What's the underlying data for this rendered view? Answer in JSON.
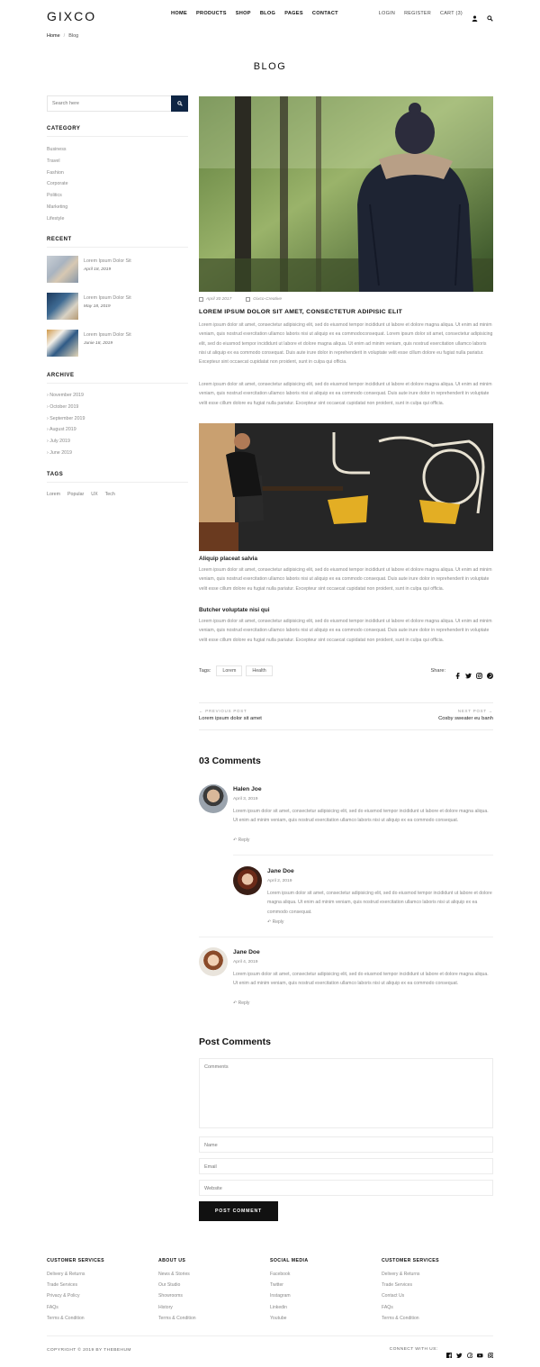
{
  "brand": {
    "logo": "GIXCO"
  },
  "nav": {
    "main": [
      "HOME",
      "PRODUCTS",
      "SHOP",
      "BLOG",
      "PAGES",
      "CONTACT"
    ],
    "login": "LOGIN",
    "register": "REGISTER",
    "cart": "CART (3)",
    "icons": [
      "user-icon",
      "search-icon"
    ]
  },
  "breadcrumb": {
    "home": "Home",
    "sep": "/",
    "current": "Blog"
  },
  "page_title": "BLOG",
  "sidebar": {
    "search_placeholder": "Search here",
    "category_heading": "CATEGORY",
    "categories": [
      "Business",
      "Travel",
      "Fashion",
      "Corporate",
      "Politics",
      "Marketing",
      "Lifestyle"
    ],
    "recent_heading": "RECENT",
    "recent": [
      {
        "title": "Lorem Ipsum Dolor Sit",
        "date": "April 18, 2019"
      },
      {
        "title": "Lorem Ipsum Dolor Sit",
        "date": "May 18, 2019"
      },
      {
        "title": "Lorem Ipsum Dolor Sit",
        "date": "Junie 18, 2019"
      }
    ],
    "archive_heading": "ARCHIVE",
    "archive": [
      "November 2019",
      "October 2019",
      "September 2019",
      "August 2019",
      "July 2019",
      "June 2019"
    ],
    "tags_heading": "TAGS",
    "tags": [
      "Lorem",
      "Popular",
      "UX",
      "Tech"
    ]
  },
  "post": {
    "date": "April 30 2017",
    "author": "Gixco-Creative",
    "title": "LOREM IPSUM DOLOR SIT AMET, CONSECTETUR ADIPISIC ELIT",
    "para1": "Lorem ipsum dolor sit amet, consectetur adipisicing elit, sed do eiusmod tempor incididunt ut labore et dolore magna aliqua. Ut enim ad minim veniam, quis nostrud exercitation ullamco laboris nisi ut aliquip ex ea commodoconsequat. Lorem ipsum dolor sit amet, consectetur adipisicing elit, sed do eiusmod tempor incididunt ut labore et dolore magna aliqua. Ut enim ad minim veniam, quis nostrud exercitation ullamco laboris nisi ut aliquip ex ea commodo consequat. Duis aute irure dolor in reprehenderit in voluptate velit esse cillum dolore eu fugiat nulla pariatur. Excepteur sint occaecat cupidatat non proident, sunt in culpa qui officia.",
    "para2": "Lorem ipsum dolor sit amet, consectetur adipisicing elit, sed do eiusmod tempor incididunt ut labore et dolore magna aliqua. Ut enim ad minim veniam, quis nostrud exercitation ullamco laboris nisi ut aliquip ex ea commodo consequat. Duis aute irure dolor in reprehenderit in voluptate velit esse cillum dolore eu fugiat nulla pariatur. Excepteur sint occaecat cupidatat non proident, sunt in culpa qui officia.",
    "sub1": "Aliquip placeat salvia",
    "para3": "Lorem ipsum dolor sit amet, consectetur adipisicing elit, sed do eiusmod tempor incididunt ut labore et dolore magna aliqua. Ut enim ad minim veniam, quis nostrud exercitation ullamco laboris nisi ut aliquip ex ea commodo consequat. Duis aute irure dolor in reprehenderit in voluptate velit esse cillum dolore eu fugiat nulla pariatur. Excepteur sint occaecat cupidatat non proident, sunt in culpa qui officia.",
    "sub2": "Butcher voluptate nisi qui",
    "para4": "Lorem ipsum dolor sit amet, consectetur adipisicing elit, sed do eiusmod tempor incididunt ut labore et dolore magna aliqua. Ut enim ad minim veniam, quis nostrud exercitation ullamco laboris nisi ut aliquip ex ea commodo consequat. Duis aute irure dolor in reprehenderit in voluptate velit esse cillum dolore eu fugiat nulla pariatur. Excepteur sint occaecat cupidatat non proident, sunt in culpa qui officia.",
    "tags_label": "Tags:",
    "tags": [
      "Lorem",
      "Health"
    ],
    "share_label": "Share:",
    "share_icons": [
      "facebook-icon",
      "twitter-icon",
      "instagram-icon",
      "pinterest-icon"
    ]
  },
  "pager": {
    "prev_label": "← PREVIOUS POST",
    "prev_title": "Lorem ipsum dolor sit amet",
    "next_label": "NEXT POST →",
    "next_title": "Cosby sweater eu banh"
  },
  "comments": {
    "heading": "03 Comments",
    "items": [
      {
        "name": "Halen Joe",
        "date": "April 3, 2019",
        "text": "Lorem ipsum dolor sit amet, consectetur adipisicing elit, sed do eiusmod tempor incididunt ut labore et dolore magna aliqua. Ut enim ad minim veniam, quis nostrud exercitation ullamco laboris nisi ut aliquip ex ea commodo consequat.",
        "reply": "Reply"
      },
      {
        "name": "Jane Doe",
        "date": "April 2, 2019",
        "text": "Lorem ipsum dolor sit amet, consectetur adipisicing elit, sed do eiusmod tempor incididunt ut labore et dolore magna aliqua. Ut enim ad minim veniam, quis nostrud exercitation ullamco laboris nisi ut aliquip ex ea commodo consequat.",
        "reply": "Reply"
      },
      {
        "name": "Jane Doe",
        "date": "April 4, 2019",
        "text": "Lorem ipsum dolor sit amet, consectetur adipisicing elit, sed do eiusmod tempor incididunt ut labore et dolore magna aliqua. Ut enim ad minim veniam, quis nostrud exercitation ullamco laboris nisi ut aliquip ex ea commodo consequat.",
        "reply": "Reply"
      }
    ]
  },
  "form": {
    "heading": "Post Comments",
    "comments_placeholder": "Comments",
    "name_placeholder": "Name",
    "email_placeholder": "Email",
    "website_placeholder": "Website",
    "submit": "POST COMMENT"
  },
  "footer": {
    "columns": [
      {
        "heading": "CUSTOMER SERVICES",
        "items": [
          "Delivery & Returns",
          "Trade Services",
          "Privacy & Policy",
          "FAQs",
          "Terms & Condition"
        ]
      },
      {
        "heading": "ABOUT US",
        "items": [
          "News & Stories",
          "Our Studio",
          "Showrooms",
          "History",
          "Terms & Condition"
        ]
      },
      {
        "heading": "SOCIAL MEDIA",
        "items": [
          "Facebook",
          "Twitter",
          "Instagram",
          "Linkedin",
          "Youtube"
        ]
      },
      {
        "heading": "CUSTOMER SERVICES",
        "items": [
          "Delivery & Returns",
          "Trade Services",
          "Contact Us",
          "FAQs",
          "Terms & Condition"
        ]
      }
    ],
    "copyright": "COPYRIGHT © 2019 BY THEBEHUM",
    "connect_label": "CONNECT WITH US:",
    "connect_icons": [
      "facebook-icon",
      "twitter-icon",
      "pinterest-icon",
      "youtube-icon",
      "instagram-icon"
    ]
  }
}
